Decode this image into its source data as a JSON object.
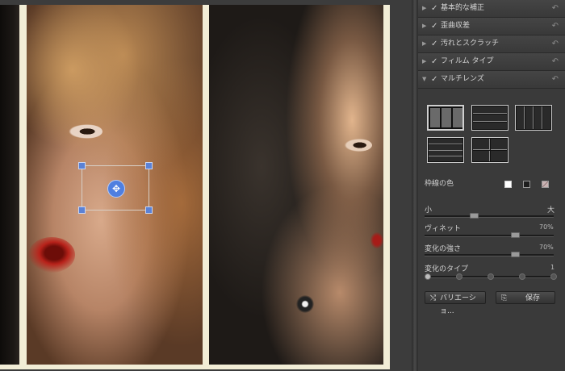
{
  "panel": {
    "sections": [
      {
        "label": "基本的な補正",
        "expanded": false,
        "checked": true
      },
      {
        "label": "歪曲収差",
        "expanded": false,
        "checked": true
      },
      {
        "label": "汚れとスクラッチ",
        "expanded": false,
        "checked": true
      },
      {
        "label": "フィルム タイプ",
        "expanded": false,
        "checked": true
      },
      {
        "label": "マルチレンズ",
        "expanded": true,
        "checked": true
      }
    ],
    "icons": {
      "collapsed": "▶",
      "expanded": "▼",
      "check": "✓",
      "reset": "↶",
      "move": "✥",
      "variation": "⤭",
      "save": "⎘"
    }
  },
  "multilens": {
    "frame_color_label": "枠線の色",
    "size_min_label": "小",
    "size_max_label": "大",
    "size_value": 0.38,
    "vignette_label": "ヴィネット",
    "vignette_value": "70%",
    "vignette_level": 0.7,
    "strength_label": "変化の強さ",
    "strength_value": "70%",
    "strength_level": 0.7,
    "type_label": "変化のタイプ",
    "type_value": "1",
    "type_stops": 5,
    "frame_colors": [
      "#ffffff",
      "#222222",
      "diagonal"
    ]
  },
  "buttons": {
    "variation_label": "バリエーショ...",
    "save_label": "保存"
  }
}
